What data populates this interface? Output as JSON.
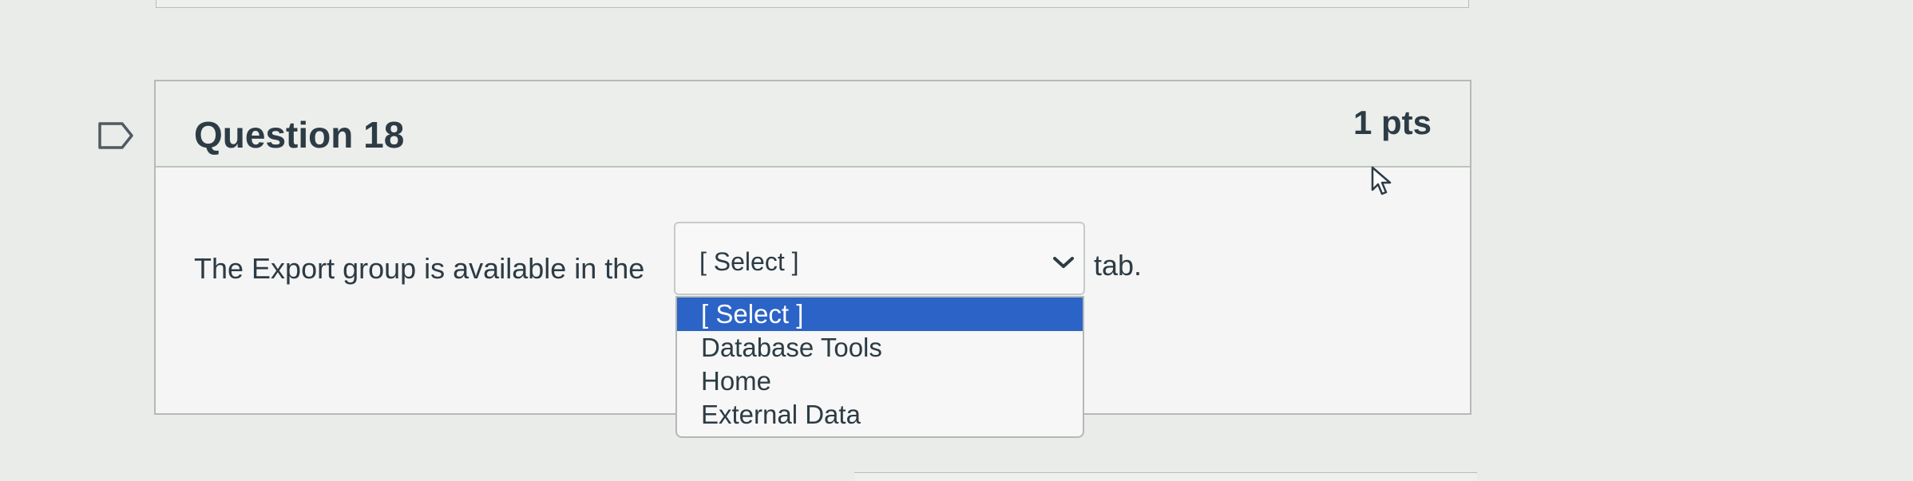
{
  "question": {
    "title": "Question 18",
    "points": "1 pts",
    "prompt_before": "The Export group is available in the",
    "prompt_after": "tab."
  },
  "select": {
    "value": "[ Select ]",
    "options": [
      "[ Select ]",
      "Database Tools",
      "Home",
      "External Data"
    ],
    "selected_index": 0
  },
  "icons": {
    "flag": "flag-icon",
    "chevron": "chevron-down-icon",
    "cursor": "mouse-cursor-icon"
  },
  "colors": {
    "highlight": "#2b63c6",
    "text": "#2d3b45"
  }
}
